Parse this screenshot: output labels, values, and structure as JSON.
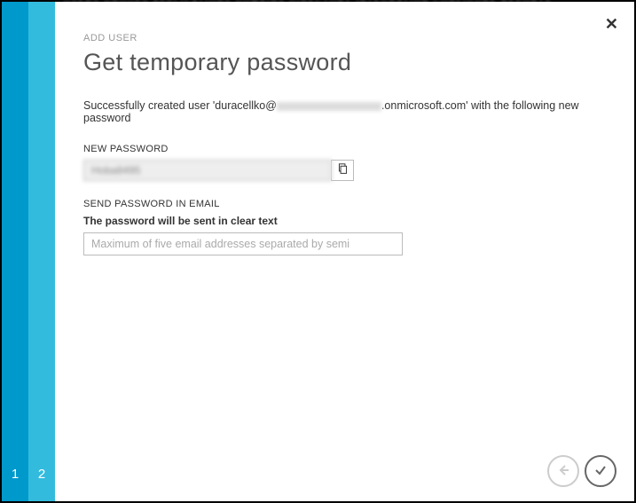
{
  "wizard": {
    "steps": [
      "1",
      "2"
    ]
  },
  "header": {
    "breadcrumb": "ADD USER",
    "title": "Get temporary password"
  },
  "message": {
    "prefix": "Successfully created user 'duracellko@",
    "suffix": ".onmicrosoft.com' with the following new password"
  },
  "password": {
    "label": "NEW PASSWORD",
    "value": "Hoba8495"
  },
  "email": {
    "label": "SEND PASSWORD IN EMAIL",
    "hint": "The password will be sent in clear text",
    "placeholder": "Maximum of five email addresses separated by semi"
  },
  "icons": {
    "close": "close-icon",
    "copy": "copy-icon",
    "back": "arrow-left-icon",
    "complete": "checkmark-icon"
  }
}
